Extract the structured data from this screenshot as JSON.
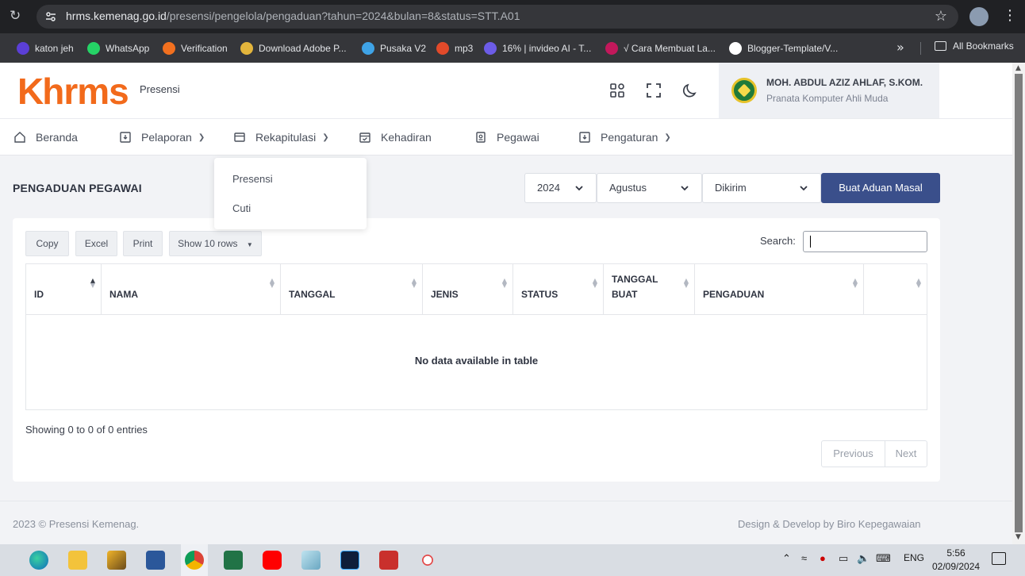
{
  "browser": {
    "url_host": "hrms.kemenag.go.id",
    "url_path": "/presensi/pengelola/pengaduan?tahun=2024&bulan=8&status=STT.A01",
    "bookmarks": [
      {
        "label": "katon jeh",
        "color": "#5b3fd6"
      },
      {
        "label": "WhatsApp",
        "color": "#25d366"
      },
      {
        "label": "Verification",
        "color": "#f2701f"
      },
      {
        "label": "Download Adobe P...",
        "color": "#e3b53c"
      },
      {
        "label": "Pusaka V2",
        "color": "#3fa3e6"
      },
      {
        "label": "mp3",
        "color": "#e24a2a"
      },
      {
        "label": "16% | invideo AI - T...",
        "color": "#6c5ce7"
      },
      {
        "label": "√ Cara Membuat La...",
        "color": "#c2185b"
      },
      {
        "label": "Blogger-Template/V...",
        "color": "#ffffff"
      }
    ],
    "all_bookmarks": "All Bookmarks"
  },
  "app": {
    "logo_k": "K",
    "logo_rest": "hrms",
    "subtitle": "Presensi",
    "user_name": "MOH. ABDUL AZIZ AHLAF, S.KOM.",
    "user_role": "Pranata Komputer Ahli Muda",
    "brand_color": "#f26a1b",
    "primary_color": "#3a4f8b"
  },
  "nav": {
    "beranda": "Beranda",
    "pelaporan": "Pelaporan",
    "rekapitulasi": "Rekapitulasi",
    "kehadiran": "Kehadiran",
    "pegawai": "Pegawai",
    "pengaturan": "Pengaturan"
  },
  "dropdown": {
    "presensi": "Presensi",
    "cuti": "Cuti"
  },
  "page": {
    "title": "PENGADUAN PEGAWAI",
    "year": "2024",
    "month": "Agustus",
    "status": "Dikirim",
    "create_button": "Buat Aduan Masal"
  },
  "table_tools": {
    "copy": "Copy",
    "excel": "Excel",
    "print": "Print",
    "show_rows": "Show 10 rows",
    "search_label": "Search:",
    "search_value": ""
  },
  "table": {
    "columns": [
      "ID",
      "NAMA",
      "TANGGAL",
      "JENIS",
      "STATUS",
      "TANGGAL BUAT",
      "PENGADUAN",
      ""
    ],
    "empty_message": "No data available in table",
    "info": "Showing 0 to 0 of 0 entries",
    "previous": "Previous",
    "next": "Next"
  },
  "footer": {
    "left": "2023 © Presensi Kemenag.",
    "right": "Design & Develop by Biro Kepegawaian"
  },
  "taskbar": {
    "language": "ENG",
    "time": "5:56",
    "date": "02/09/2024"
  }
}
